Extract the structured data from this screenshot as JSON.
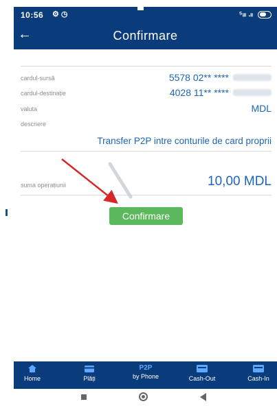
{
  "status_bar": {
    "time": "10:56",
    "icons": "⚙ ◷",
    "signal": "⁵ᵢₗₗ .ₗₗ",
    "battery": "98"
  },
  "header": {
    "back_icon": "arrow-left-icon",
    "title": "Confirmare"
  },
  "details": {
    "source_card_label": "cardul-sursă",
    "source_card_value": "5578 02** ****",
    "dest_card_label": "cardul-destinație",
    "dest_card_value": "4028 11** ****",
    "currency_label": "valuta",
    "currency_value": "MDL",
    "description_label": "descriere",
    "description_value": "Transfer P2P intre conturile de card proprii",
    "amount_label": "suma operațiunii",
    "amount_value": "10,00 MDL"
  },
  "actions": {
    "confirm_label": "Confirmare"
  },
  "annotation": {
    "arrow_color": "#d62828"
  },
  "tabbar": {
    "items": [
      {
        "label": "Home",
        "icon": "home-icon"
      },
      {
        "label": "Plăți",
        "icon": "card-icon"
      },
      {
        "top": "P2P",
        "label": "by Phone",
        "icon": "p2p-text"
      },
      {
        "label": "Cash-Out",
        "icon": "atm-icon"
      },
      {
        "label": "Cash-In",
        "icon": "atm-icon"
      }
    ]
  },
  "colors": {
    "header_bg": "#0a3b7a",
    "value_blue": "#1c66b8",
    "confirm_green": "#5cb85c",
    "p2p_blue": "#5fa8ff"
  }
}
